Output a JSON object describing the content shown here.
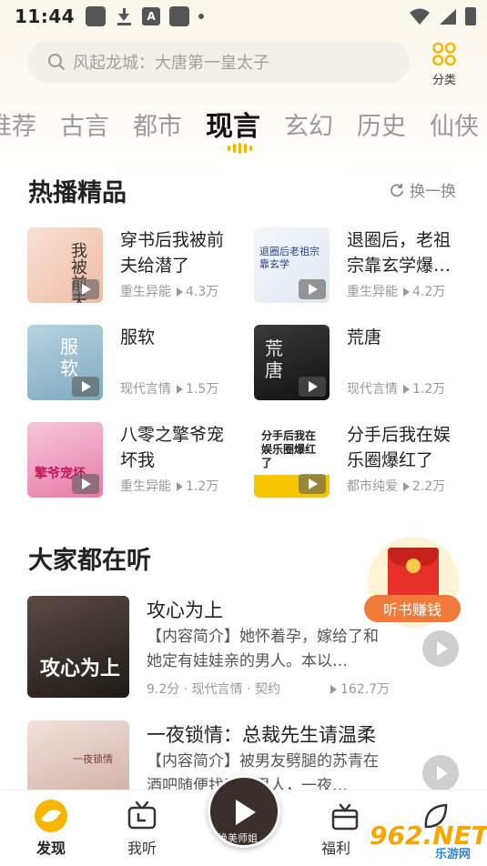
{
  "status_bar": {
    "time": "11:44"
  },
  "search": {
    "placeholder": "风起龙城：大唐第一皇太子"
  },
  "category": {
    "label": "分类"
  },
  "tabs": [
    {
      "label": "推荐"
    },
    {
      "label": "古言"
    },
    {
      "label": "都市"
    },
    {
      "label": "现言",
      "active": true
    },
    {
      "label": "玄幻"
    },
    {
      "label": "历史"
    },
    {
      "label": "仙侠"
    }
  ],
  "hot_section": {
    "title": "热播精品",
    "refresh_label": "换一换",
    "items": [
      {
        "title": "穿书后我被前夫给潜了",
        "genre": "重生异能",
        "plays": "4.3万",
        "cover_text": "我被前夫",
        "cover_color": "#f5d7c4"
      },
      {
        "title": "退圈后，老祖宗靠玄学爆…",
        "genre": "重生异能",
        "plays": "4.2万",
        "cover_text": "退圈后老祖宗靠玄学",
        "cover_color": "#eef3f7"
      },
      {
        "title": "服软",
        "genre": "现代言情",
        "plays": "1.5万",
        "cover_text": "服软",
        "cover_color": "#9bbfd0"
      },
      {
        "title": "荒唐",
        "genre": "现代言情",
        "plays": "1.2万",
        "cover_text": "荒唐",
        "cover_color": "#2b2b2b"
      },
      {
        "title": "八零之擎爷宠坏我",
        "genre": "重生异能",
        "plays": "1.2万",
        "cover_text": "擎爷宠坏",
        "cover_color": "#f2a9c6"
      },
      {
        "title": "分手后我在娱乐圈爆红了",
        "genre": "都市纯爱",
        "plays": "2.2万",
        "cover_text": "分手后我在娱乐圈爆红了",
        "cover_color": "#fbf3d8"
      }
    ]
  },
  "listen_section": {
    "title": "大家都在听",
    "items": [
      {
        "title": "攻心为上",
        "desc": "【内容简介】她怀着孕，嫁给了和她定有娃娃亲的男人。本以…",
        "meta": "9.2分 · 现代言情 · 契约",
        "plays": "162.7万",
        "cover_text": "攻心为上",
        "cover_color": "#2c2622"
      },
      {
        "title": "一夜锁情：总裁先生请温柔",
        "desc": "【内容简介】被男友劈腿的苏青在酒吧随便找了个男人，一夜…",
        "meta": "",
        "plays": "",
        "cover_text": "一夜锁情",
        "cover_color": "#e9d3cc"
      }
    ]
  },
  "floating": {
    "label": "听书赚钱"
  },
  "bottom_nav": {
    "items": [
      {
        "label": "发现",
        "active": true
      },
      {
        "label": "我听"
      },
      {
        "label": "福利"
      },
      {
        "label": ""
      }
    ],
    "player_text": "绝美师姐"
  },
  "watermark": {
    "text": "962.NET",
    "sub": "乐游网"
  },
  "colors": {
    "accent": "#f7b500",
    "tab_active": "#111111",
    "redpack": "#e8302a"
  }
}
